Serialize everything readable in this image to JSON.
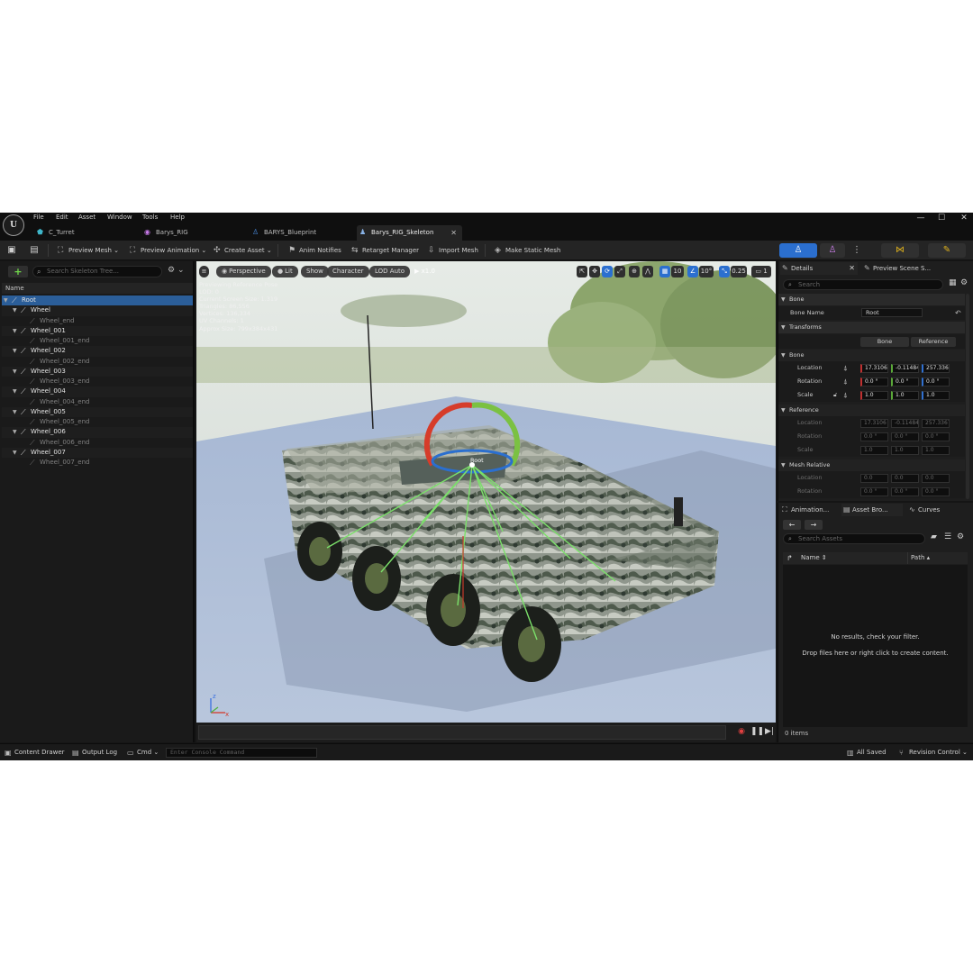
{
  "menu": {
    "logo": "U",
    "items": [
      "File",
      "Edit",
      "Asset",
      "Window",
      "Tools",
      "Help"
    ],
    "window_controls": [
      "—",
      "☐",
      "✕"
    ]
  },
  "tabs": [
    {
      "label": "C_Turret",
      "icon": "blueprint-icon",
      "color": "#3fb6c9"
    },
    {
      "label": "Barys_RIG",
      "icon": "control-rig-icon",
      "color": "#c779e8"
    },
    {
      "label": "BARYS_Blueprint",
      "icon": "character-icon",
      "color": "#4a8de0"
    },
    {
      "label": "Barys_RIG_Skeleton",
      "icon": "skeleton-icon",
      "color": "#8ab4e8",
      "active": true
    }
  ],
  "toolbar": {
    "preview_mesh": "Preview Mesh",
    "preview_animation": "Preview Animation",
    "create_asset": "Create Asset",
    "anim_notifies": "Anim Notifies",
    "retarget_manager": "Retarget Manager",
    "import_mesh": "Import Mesh",
    "make_static_mesh": "Make Static Mesh"
  },
  "skeleton_tree": {
    "search_placeholder": "Search Skeleton Tree...",
    "column_header": "Name",
    "bones": [
      {
        "label": "Root",
        "depth": 0,
        "selected": true,
        "has_children": true
      },
      {
        "label": "Wheel",
        "depth": 1,
        "has_children": true
      },
      {
        "label": "Wheel_end",
        "depth": 2,
        "end": true
      },
      {
        "label": "Wheel_001",
        "depth": 1,
        "has_children": true
      },
      {
        "label": "Wheel_001_end",
        "depth": 2,
        "end": true
      },
      {
        "label": "Wheel_002",
        "depth": 1,
        "has_children": true
      },
      {
        "label": "Wheel_002_end",
        "depth": 2,
        "end": true
      },
      {
        "label": "Wheel_003",
        "depth": 1,
        "has_children": true
      },
      {
        "label": "Wheel_003_end",
        "depth": 2,
        "end": true
      },
      {
        "label": "Wheel_004",
        "depth": 1,
        "has_children": true
      },
      {
        "label": "Wheel_004_end",
        "depth": 2,
        "end": true
      },
      {
        "label": "Wheel_005",
        "depth": 1,
        "has_children": true
      },
      {
        "label": "Wheel_005_end",
        "depth": 2,
        "end": true
      },
      {
        "label": "Wheel_006",
        "depth": 1,
        "has_children": true
      },
      {
        "label": "Wheel_006_end",
        "depth": 2,
        "end": true
      },
      {
        "label": "Wheel_007",
        "depth": 1,
        "has_children": true
      },
      {
        "label": "Wheel_007_end",
        "depth": 2,
        "end": true
      }
    ]
  },
  "viewport": {
    "perspective": "Perspective",
    "lit": "Lit",
    "show": "Show",
    "character": "Character",
    "lod": "LOD Auto",
    "play_speed": "x1.0",
    "grid_snap": "10",
    "rotation_snap": "10°",
    "scale_snap": "0.25",
    "camera_speed": "1",
    "stats": [
      "Previewing Reference Pose",
      "LOD: 0",
      "Current Screen Size: 1.319",
      "Triangles: 86,556",
      "Vertices: 136,334",
      "UV Channels: 1",
      "Approx Size: 799x384x431"
    ],
    "root_label": "Root",
    "axis_z": "z",
    "axis_x": "x"
  },
  "details": {
    "tab_details": "Details",
    "tab_preview": "Preview Scene S...",
    "search_placeholder": "Search",
    "section_bone": "Bone",
    "bone_name_label": "Bone Name",
    "bone_name_value": "Root",
    "section_transforms": "Transforms",
    "btn_bone": "Bone",
    "btn_reference": "Reference",
    "sub_bone": "Bone",
    "sub_reference": "Reference",
    "sub_mesh_relative": "Mesh Relative",
    "labels": {
      "location": "Location",
      "rotation": "Rotation",
      "scale": "Scale"
    },
    "bone": {
      "location": [
        "17.3106",
        "-0.11484",
        "257.3367"
      ],
      "rotation": [
        "0.0 °",
        "0.0 °",
        "0.0 °"
      ],
      "scale": [
        "1.0",
        "1.0",
        "1.0"
      ]
    },
    "reference": {
      "location": [
        "17.3106",
        "-0.11484",
        "257.3367"
      ],
      "rotation": [
        "0.0 °",
        "0.0 °",
        "0.0 °"
      ],
      "scale": [
        "1.0",
        "1.0",
        "1.0"
      ]
    },
    "mesh_relative": {
      "location": [
        "0.0",
        "0.0",
        "0.0"
      ],
      "rotation": [
        "0.0 °",
        "0.0 °",
        "0.0 °"
      ]
    }
  },
  "assets": {
    "tab_animation": "Animation...",
    "tab_asset_browser": "Asset Bro...",
    "tab_curves": "Curves",
    "search_placeholder": "Search Assets",
    "col_name": "Name",
    "col_path": "Path",
    "empty_line1": "No results, check your filter.",
    "empty_line2": "Drop files here or right click to create content.",
    "count": "0 items"
  },
  "statusbar": {
    "content_drawer": "Content Drawer",
    "output_log": "Output Log",
    "cmd": "Cmd",
    "console_placeholder": "Enter Console Command",
    "all_saved": "All Saved",
    "revision_control": "Revision Control"
  },
  "colors": {
    "accent_blue": "#2b6fcf",
    "selection": "#2b5e99",
    "bone_lines": "#7be06a",
    "mode_button_yellow": "#e0b21c"
  }
}
